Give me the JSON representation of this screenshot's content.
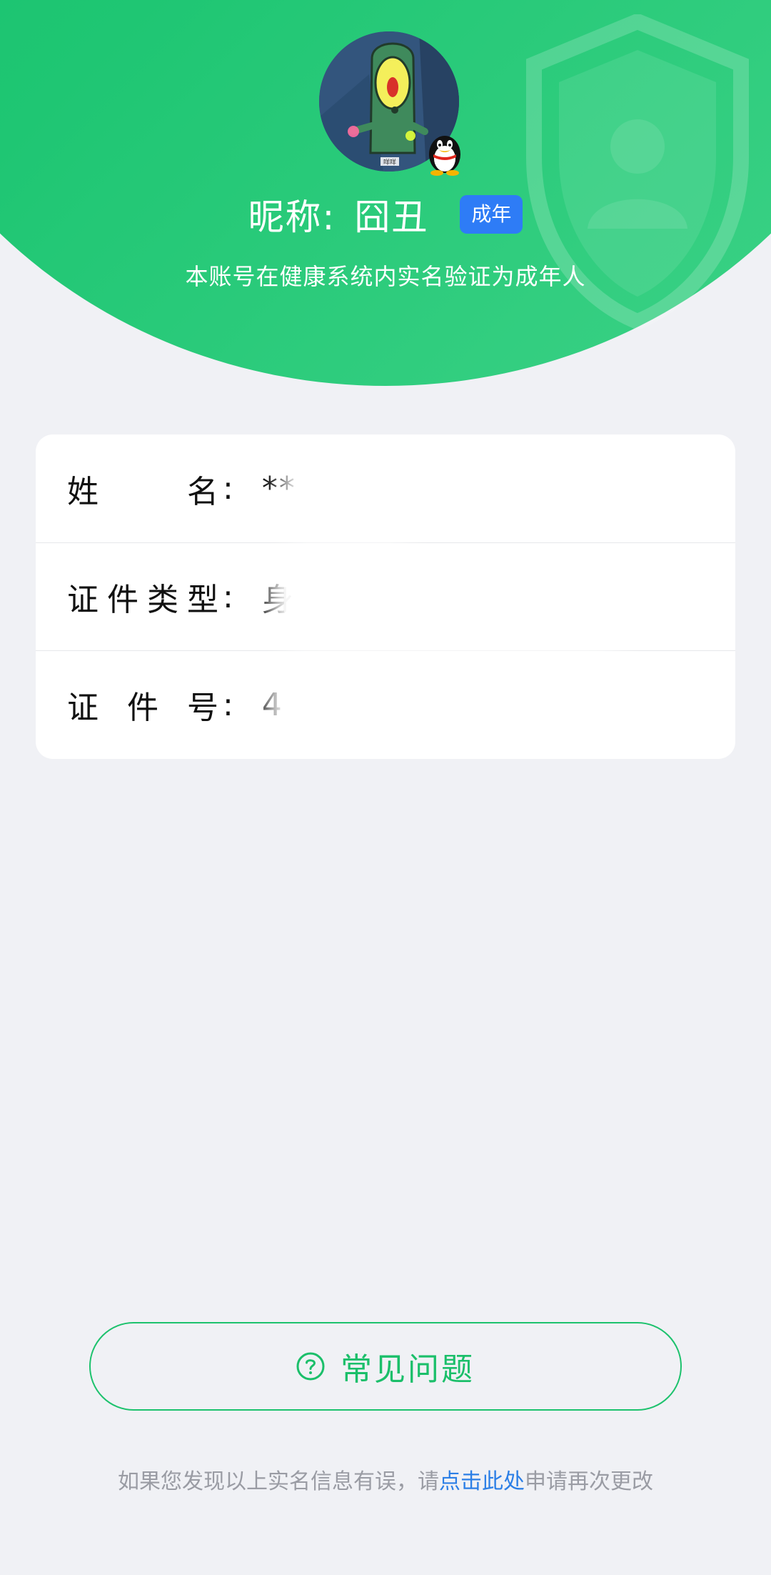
{
  "header": {
    "nickname_label": "昵称:",
    "nickname_value": "囧丑",
    "badge": "成年",
    "subtitle": "本账号在健康系统内实名验证为成年人",
    "avatar_caption": "咩咩",
    "icons": [
      "avatar",
      "qq-penguin-icon",
      "shield-icon"
    ]
  },
  "info": {
    "name": {
      "label_chars": [
        "姓",
        "名"
      ],
      "colon": ":",
      "value": "**"
    },
    "id_type": {
      "label_chars": [
        "证",
        "件",
        "类",
        "型"
      ],
      "colon": ":",
      "value": "身"
    },
    "id_number": {
      "label_chars": [
        "证",
        "件",
        "号"
      ],
      "colon": ":",
      "value": "4"
    }
  },
  "faq": {
    "icon": "question-circle-icon",
    "label": "常见问题"
  },
  "footer": {
    "prefix": "如果您发现以上实名信息有误，请",
    "link": "点击此处",
    "suffix": "申请再次更改"
  },
  "colors": {
    "brand_green": "#1dc26d",
    "badge_blue": "#2e7cf6",
    "link_blue": "#2c7fe6",
    "page_bg": "#f0f1f5"
  }
}
